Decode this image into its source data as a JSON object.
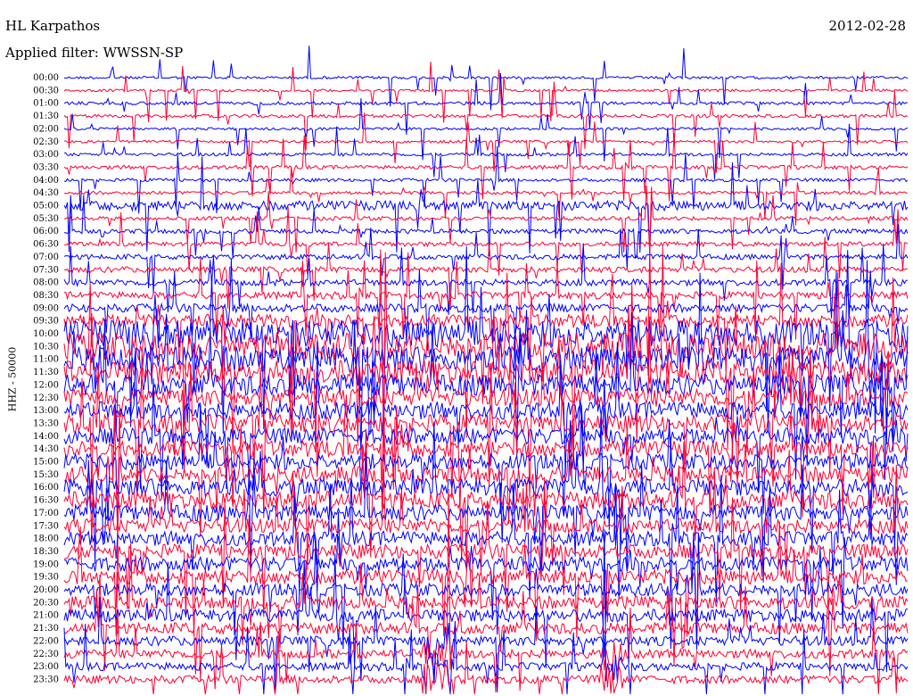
{
  "header": {
    "station": "HL Karpathos",
    "date": "2012-02-28",
    "filter_text": "Applied filter: WWSSN-SP"
  },
  "chart_data": {
    "type": "line",
    "title": "HL Karpathos",
    "subtitle": "Applied filter: WWSSN-SP",
    "ylabel": "HHZ - 50000",
    "xlabel": "",
    "grid": false,
    "legend": "none",
    "row_labels": [
      "00:00",
      "00:30",
      "01:00",
      "01:30",
      "02:00",
      "02:30",
      "03:00",
      "03:30",
      "04:00",
      "04:30",
      "05:00",
      "05:30",
      "06:00",
      "06:30",
      "07:00",
      "07:30",
      "08:00",
      "08:30",
      "09:00",
      "09:30",
      "10:00",
      "10:30",
      "11:00",
      "11:30",
      "12:00",
      "12:30",
      "13:00",
      "13:30",
      "14:00",
      "14:30",
      "15:00",
      "15:30",
      "16:00",
      "16:30",
      "17:00",
      "17:30",
      "18:00",
      "18:30",
      "19:00",
      "19:30",
      "20:00",
      "20:30",
      "21:00",
      "21:30",
      "22:00",
      "22:30",
      "23:00",
      "23:30"
    ],
    "colors": [
      "#0000ff",
      "#ff0033"
    ],
    "amplitude_levels": [
      0.08,
      0.08,
      0.1,
      0.1,
      0.08,
      0.08,
      0.1,
      0.12,
      0.1,
      0.1,
      0.3,
      0.12,
      0.14,
      0.14,
      0.16,
      0.18,
      0.2,
      0.22,
      0.26,
      0.4,
      0.85,
      0.85,
      0.8,
      0.75,
      0.65,
      0.55,
      0.55,
      0.55,
      0.5,
      0.5,
      0.5,
      0.5,
      0.55,
      0.55,
      0.5,
      0.45,
      0.45,
      0.45,
      0.45,
      0.45,
      0.4,
      0.4,
      0.4,
      0.35,
      0.3,
      0.28,
      0.25,
      0.25
    ]
  }
}
